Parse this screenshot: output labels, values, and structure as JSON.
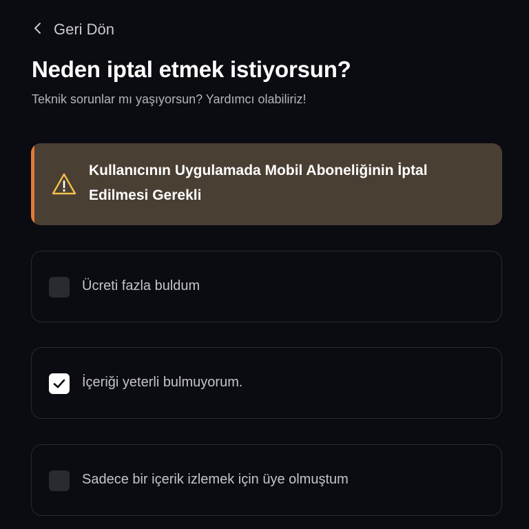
{
  "back": {
    "label": "Geri Dön"
  },
  "header": {
    "title": "Neden iptal etmek istiyorsun?",
    "subtitle": "Teknik sorunlar mı yaşıyorsun? Yardımcı olabiliriz!"
  },
  "alert": {
    "icon": "warning-icon",
    "message": "Kullanıcının Uygulamada Mobil Aboneliğinin İptal Edilmesi Gerekli",
    "accent_color": "#e07a3a",
    "background_color": "#4a3f33"
  },
  "options": [
    {
      "label": "Ücreti fazla buldum",
      "checked": false
    },
    {
      "label": "İçeriği yeterli bulmuyorum.",
      "checked": true
    },
    {
      "label": "Sadece bir içerik izlemek için üye olmuştum",
      "checked": false
    }
  ]
}
